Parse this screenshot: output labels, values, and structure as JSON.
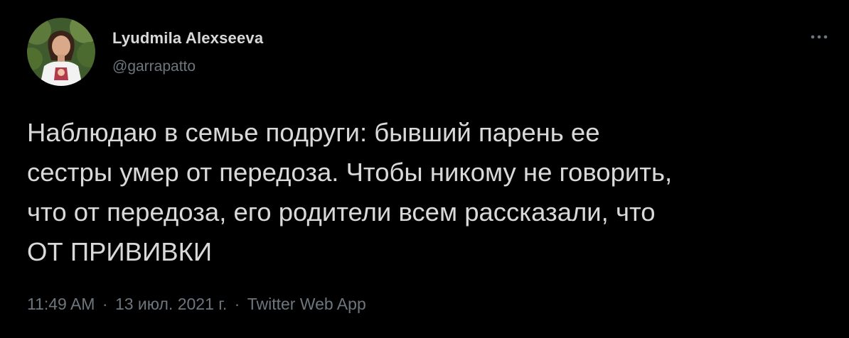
{
  "author": {
    "display_name": "Lyudmila Alexseeva",
    "handle": "@garrapatto"
  },
  "more_menu_icon": "more-horizontal-icon",
  "tweet": {
    "lines": [
      "Наблюдаю в семье подруги: бывший парень ее",
      "сестры умер от передоза. Чтобы никому не говорить,",
      "что от передоза, его родители всем рассказали, что",
      "ОТ ПРИВИВКИ"
    ]
  },
  "meta": {
    "time": "11:49 AM",
    "separator": "·",
    "date": "13 июл. 2021 г.",
    "source": "Twitter Web App"
  },
  "colors": {
    "background": "#000000",
    "primary_text": "#d9d9d9",
    "secondary_text": "#6e767d"
  }
}
